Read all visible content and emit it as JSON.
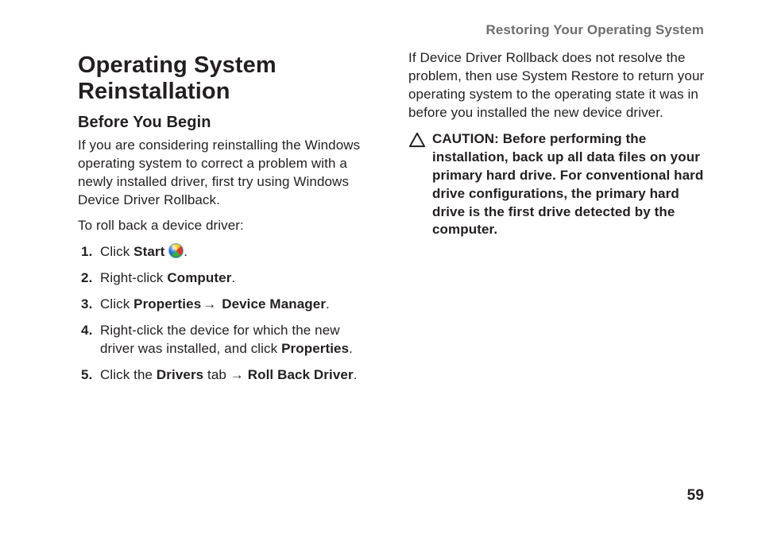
{
  "running_head": "Restoring Your Operating System",
  "page_number": "59",
  "left": {
    "title": "Operating System Reinstallation",
    "subhead": "Before You Begin",
    "intro": "If you are considering reinstalling the Windows operating system to correct a problem with a newly installed driver, first try using Windows Device Driver Rollback.",
    "lead_in": "To roll back a device driver:",
    "steps": {
      "s1_a": "Click ",
      "s1_b": "Start",
      "s1_c": " ",
      "s1_d": ".",
      "s2_a": "Right-click ",
      "s2_b": "Computer",
      "s2_c": ".",
      "s3_a": "Click ",
      "s3_b": "Properties",
      "s3_c": "→ ",
      "s3_d": "Device Manager",
      "s3_e": ".",
      "s4_a": "Right-click the device for which the new driver was installed, and click ",
      "s4_b": "Properties",
      "s4_c": ".",
      "s5_a": "Click the ",
      "s5_b": "Drivers",
      "s5_c": " tab → ",
      "s5_d": "Roll Back Driver",
      "s5_e": "."
    }
  },
  "right": {
    "para": "If Device Driver Rollback does not resolve the problem, then use System Restore to return your operating system to the operating state it was in before you installed the new device driver.",
    "caution": "CAUTION: Before performing the installation, back up all data files on your primary hard drive. For conventional hard drive configurations, the primary hard drive is the first drive detected by the computer."
  }
}
